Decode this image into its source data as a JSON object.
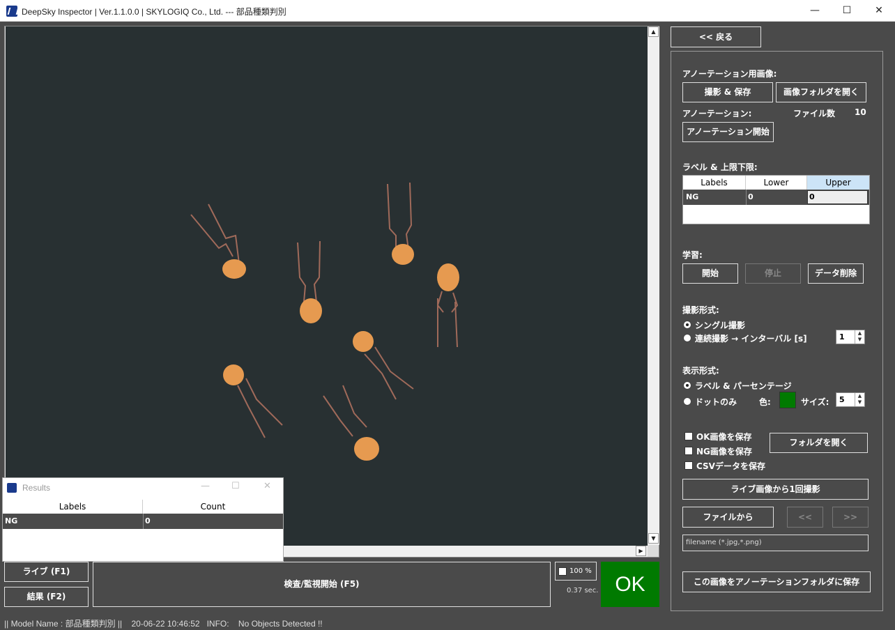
{
  "window": {
    "title": "DeepSky Inspector | Ver.1.1.0.0 | SKYLOGIQ Co., Ltd. --- 部品種類判別",
    "minimize": "—",
    "maximize": "☐",
    "close": "✕"
  },
  "top": {
    "back_label": "<< 戻る"
  },
  "annotation_images": {
    "heading": "アノーテーション用画像:",
    "capture_save": "撮影 & 保存",
    "open_image_folder": "画像フォルダを開く"
  },
  "annotation": {
    "heading": "アノーテーション:",
    "file_count_label": "ファイル数",
    "file_count": "10",
    "start_label": "アノーテーション開始"
  },
  "labels_limits": {
    "heading": "ラベル & 上限下限:",
    "columns": [
      "Labels",
      "Lower",
      "Upper"
    ],
    "rows": [
      [
        "NG",
        "0",
        "0"
      ]
    ]
  },
  "learning": {
    "heading": "学習:",
    "start": "開始",
    "stop": "停止",
    "delete_data": "データ削除"
  },
  "capture_mode": {
    "heading": "撮影形式:",
    "single": "シングル撮影",
    "continuous": "連続撮影 → インターバル [s]",
    "interval": "1"
  },
  "display_mode": {
    "heading": "表示形式:",
    "label_percentage": "ラベル & パーセンテージ",
    "dots_only": "ドットのみ",
    "color_label": "色:",
    "size_label": "サイズ:",
    "size": "5",
    "dot_color": "#007a00"
  },
  "save_options": {
    "ok_images": "OK画像を保存",
    "ng_images": "NG画像を保存",
    "csv": "CSVデータを保存",
    "open_folder": "フォルダを開く"
  },
  "capture": {
    "live_once": "ライブ画像から1回撮影",
    "from_file": "ファイルから",
    "prev": "<<",
    "next": ">>",
    "filename_placeholder": "filename (*.jpg,*.png)",
    "save_to_annotation": "この画像をアノーテーションフォルダに保存"
  },
  "bottom": {
    "live": "ライブ (F1)",
    "results": "結果 (F2)",
    "inspect": "検査/監視開始 (F5)",
    "zoom": "100 %",
    "time": "0.37 sec.",
    "verdict": "OK",
    "verdict_color": "#007a00"
  },
  "results_window": {
    "title": "Results",
    "columns": [
      "Labels",
      "Count"
    ],
    "rows": [
      [
        "NG",
        "0"
      ]
    ]
  },
  "status": {
    "text": "|| Model Name : 部品種類判別 ||    20-06-22 10:46:52   INFO:    No Objects Detected !!"
  }
}
